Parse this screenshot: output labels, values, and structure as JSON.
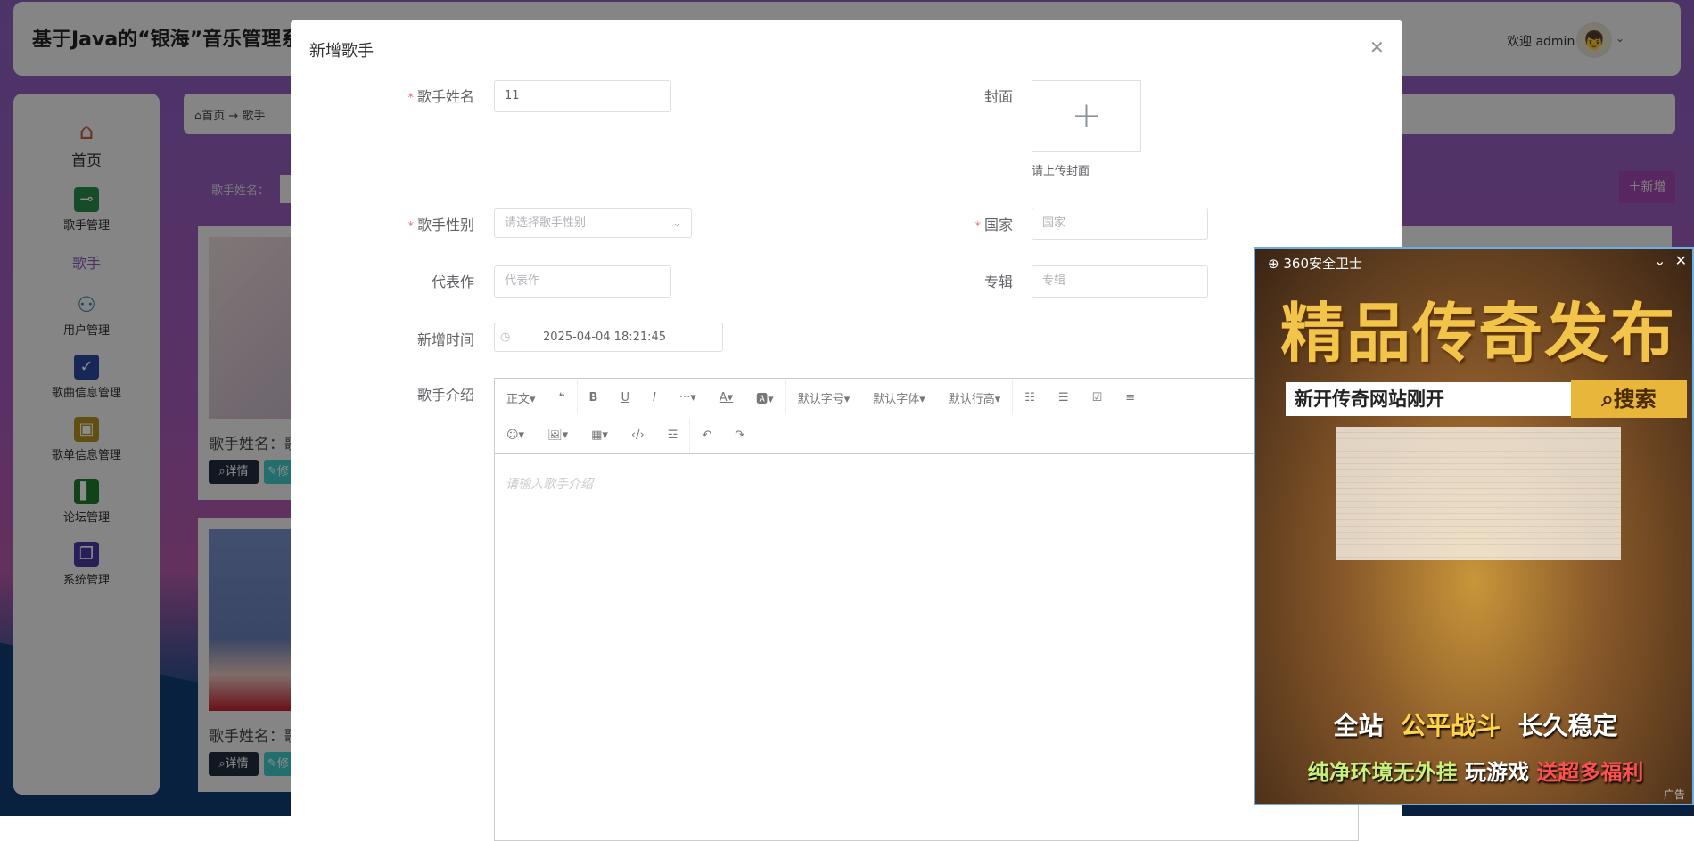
{
  "app": {
    "title": "基于Java的“银海”音乐管理系",
    "welcome": "欢迎 admin"
  },
  "sidebar": {
    "items": [
      {
        "label": "首页",
        "icon": "home-icon",
        "color": "#c0603a"
      },
      {
        "label": "歌手管理",
        "icon": "singer-manage-icon",
        "color": "#2a8a4a"
      },
      {
        "label": "歌手",
        "icon": "",
        "color": ""
      },
      {
        "label": "用户管理",
        "icon": "user-icon",
        "color": "#2a7fb0"
      },
      {
        "label": "歌曲信息管理",
        "icon": "song-icon",
        "color": "#2a48a0"
      },
      {
        "label": "歌单信息管理",
        "icon": "chip-icon",
        "color": "#b0901e"
      },
      {
        "label": "论坛管理",
        "icon": "forum-icon",
        "color": "#1e7a2a"
      },
      {
        "label": "系统管理",
        "icon": "system-icon",
        "color": "#4a3aa0"
      }
    ]
  },
  "breadcrumb": {
    "home": "首页",
    "arrow": "→",
    "current": "歌手"
  },
  "search": {
    "label": "歌手姓名："
  },
  "toolbar": {
    "add": "＋新增"
  },
  "cards": [
    {
      "name": "歌手姓名：歌",
      "detail": "详情",
      "edit": "修"
    },
    {
      "name": "歌手姓名：歌",
      "detail": "详情",
      "edit": "修"
    }
  ],
  "modal": {
    "title": "新增歌手",
    "fields": {
      "name": {
        "label": "歌手姓名",
        "value": "11",
        "required": true
      },
      "cover": {
        "label": "封面",
        "hint": "请上传封面"
      },
      "gender": {
        "label": "歌手性别",
        "placeholder": "请选择歌手性别",
        "required": true
      },
      "country": {
        "label": "国家",
        "placeholder": "国家",
        "required": true
      },
      "works": {
        "label": "代表作",
        "placeholder": "代表作"
      },
      "album": {
        "label": "专辑",
        "placeholder": "专辑"
      },
      "time": {
        "label": "新增时间",
        "value": "2025-04-04 18:21:45"
      },
      "intro": {
        "label": "歌手介绍",
        "placeholder": "请输入歌手介绍"
      }
    },
    "editor": {
      "row1": [
        "正文▾",
        "❝",
        "B",
        "U",
        "I",
        "···▾",
        "A▾",
        "🅰▾",
        "默认字号▾",
        "默认字体▾",
        "默认行高▾",
        "☷",
        "☰",
        "☑",
        "≡"
      ],
      "row2": [
        "☺▾",
        "🖼▾",
        "▦▾",
        "‹/›",
        "☲",
        "↶",
        "↷"
      ]
    }
  },
  "ad": {
    "brand": "360安全卫士",
    "title": "精品传奇发布",
    "search_text": "新开传奇网站刚开",
    "search_btn": "搜索",
    "line1a": "全站",
    "line1b": "公平战斗",
    "line1c": "长久稳定",
    "line2a": "纯净环境无外挂",
    "line2b": "玩游戏",
    "line2c": "送超多福利",
    "tag": "广告"
  }
}
